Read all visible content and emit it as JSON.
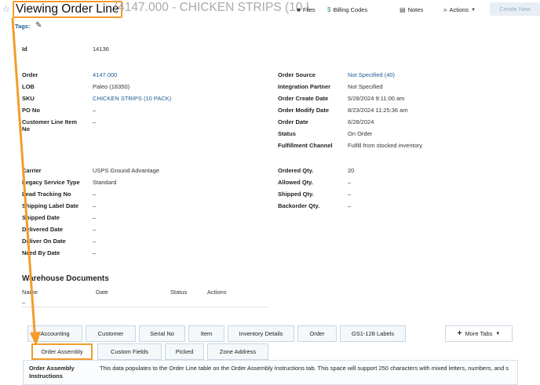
{
  "header": {
    "title": "Viewing Order Line",
    "subtitle": "(4147.000 - CHICKEN STRIPS (10 I",
    "toolbar": {
      "files": "Files",
      "billing_codes": "Billing Codes",
      "notes": "Notes",
      "actions": "Actions",
      "create_new": "Create New"
    }
  },
  "tags_label": "Tags:",
  "id_field": {
    "label": "Id",
    "value": "14136"
  },
  "left_fields": [
    {
      "label": "Order",
      "value": "4147.000"
    },
    {
      "label": "LOB",
      "value": "Paleo (18350)"
    },
    {
      "label": "SKU",
      "value": "CHICKEN STRIPS (10 PACK)"
    },
    {
      "label": "PO No",
      "value": "–"
    },
    {
      "label": "Customer Line Item",
      "label2": "No",
      "value": "–"
    }
  ],
  "right_fields": [
    {
      "label": "Order Source",
      "value": "Not Specified (40)"
    },
    {
      "label": "Integration Partner",
      "value": "Not Specified"
    },
    {
      "label": "Order Create Date",
      "value": "5/28/2024  9:11:00 am"
    },
    {
      "label": "Order Modify Date",
      "value": "8/23/2024  11:25:36 am"
    },
    {
      "label": "Order Date",
      "value": "6/28/2024"
    },
    {
      "label": "Status",
      "value": "On Order"
    },
    {
      "label": "Fulfillment Channel",
      "value": "Fulfill from stocked inventory"
    }
  ],
  "shipping_fields": [
    {
      "label": "Carrier",
      "value": "USPS Ground Advantage"
    },
    {
      "label": "Legacy Service Type",
      "value": "Standard"
    },
    {
      "label": "Lead Tracking No",
      "value": "–"
    },
    {
      "label": "Shipping Label Date",
      "value": "–"
    },
    {
      "label": "Shipped Date",
      "value": "–"
    },
    {
      "label": "Delivered Date",
      "value": "–"
    },
    {
      "label": "Deliver On Date",
      "value": "–"
    },
    {
      "label": "Need By Date",
      "value": "–"
    }
  ],
  "qty_fields": [
    {
      "label": "Ordered Qty.",
      "value": "20"
    },
    {
      "label": "Allowed Qty.",
      "value": "–"
    },
    {
      "label": "Shipped Qty.",
      "value": "–"
    },
    {
      "label": "Backorder Qty.",
      "value": "–"
    }
  ],
  "warehouse": {
    "title": "Warehouse Documents",
    "columns": [
      "Name",
      "Date",
      "Status",
      "Actions"
    ],
    "empty_row": "–"
  },
  "tabs_row1": [
    "Accounting",
    "Customer",
    "Serial No",
    "Item",
    "Inventory Details",
    "Order",
    "GS1-128 Labels"
  ],
  "tabs_row2": [
    "Order Assembly",
    "Custom Fields",
    "Picked",
    "Zone Address"
  ],
  "more_tabs": "More Tabs",
  "assembly": {
    "label": "Order Assembly",
    "label2": "Instructions",
    "text": "This data populates to the Order Line table on the Order Assembly Instructions tab. This space will support 250 characters with mixed letters, numbers, and s"
  },
  "colors": {
    "highlight": "#f39c2b",
    "link": "#1e5a96"
  }
}
